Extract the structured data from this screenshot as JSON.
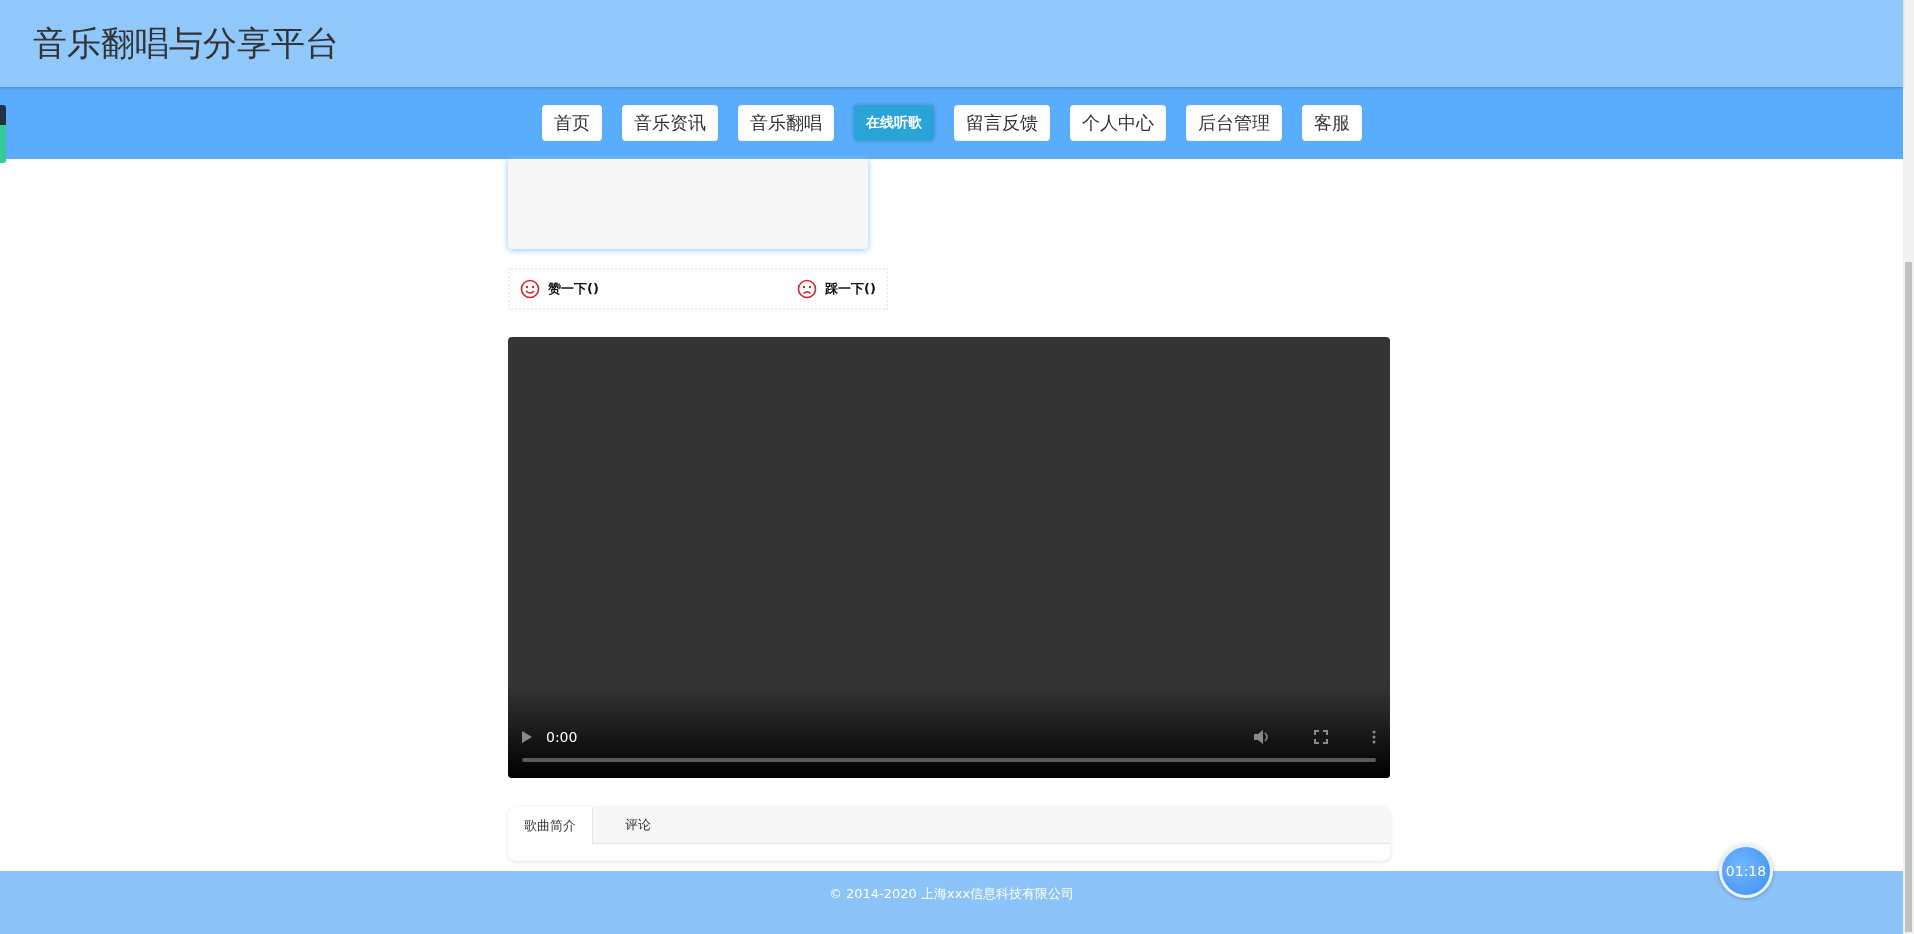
{
  "site_title": "音乐翻唱与分享平台",
  "nav": [
    {
      "label": "首页",
      "selected": false
    },
    {
      "label": "音乐资讯",
      "selected": false
    },
    {
      "label": "音乐翻唱",
      "selected": false
    },
    {
      "label": "在线听歌",
      "selected": true
    },
    {
      "label": "留言反馈",
      "selected": false
    },
    {
      "label": "个人中心",
      "selected": false
    },
    {
      "label": "后台管理",
      "selected": false
    },
    {
      "label": "客服",
      "selected": false
    }
  ],
  "vote": {
    "like": "赞一下()",
    "dislike": "踩一下()"
  },
  "video": {
    "time": "0:00"
  },
  "tabs": [
    {
      "label": "歌曲简介",
      "selected": true
    },
    {
      "label": "评论",
      "selected": false
    }
  ],
  "footer": "© 2014-2020 上海xxx信息科技有限公司",
  "timer": "01:18"
}
